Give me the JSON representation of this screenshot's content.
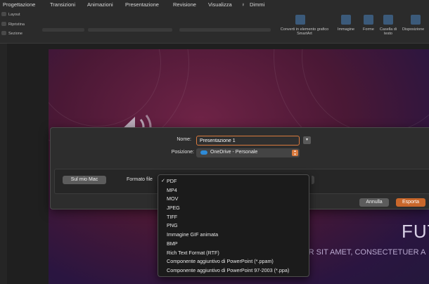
{
  "ribbon": {
    "tabs": [
      "Progettazione",
      "Transizioni",
      "Animazioni",
      "Presentazione",
      "Revisione",
      "Visualizza",
      "Dimmi"
    ],
    "layout_label": "Layout",
    "reset_label": "Ripristina",
    "section_label": "Sezione",
    "convert_label": "Converti in elemento grafico SmartArt",
    "image_label": "Immagine",
    "shapes_label": "Forme",
    "textbox_label": "Casella di testo",
    "arrange_label": "Disposizione"
  },
  "slide": {
    "title_fragment": "FUT",
    "subtitle_fragment": "LOR SIT AMET, CONSECTETUER A"
  },
  "dialog": {
    "name_label": "Nome:",
    "name_value": "Presentazione 1",
    "position_label": "Posizione:",
    "position_value": "OneDrive - Personale",
    "on_my_mac_label": "Sul mio Mac",
    "format_label": "Formato file",
    "cancel_label": "Annulla",
    "export_label": "Esporta"
  },
  "format_menu": {
    "selected": "PDF",
    "items": [
      "PDF",
      "MP4",
      "MOV",
      "JPEG",
      "TIFF",
      "PNG",
      "Immagine GIF animata",
      "BMP",
      "Rich Text Format (RTF)",
      "Componente aggiuntivo di PowerPoint (*.ppam)",
      "Componente aggiuntivo di PowerPoint 97-2003 (*.ppa)"
    ]
  },
  "colors": {
    "accent": "#d97a3e",
    "export": "#c9672b",
    "slide_bg": "#4a1835"
  }
}
